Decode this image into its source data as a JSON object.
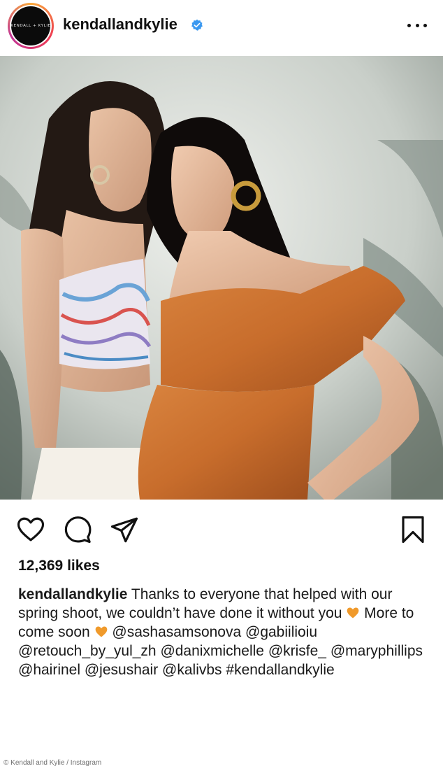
{
  "header": {
    "avatar_logo_text": "KENDALL + KYLIE",
    "username": "kendallandkylie",
    "verified_icon": "verified-badge-icon",
    "more_icon": "more-options-icon"
  },
  "post": {
    "image_description_icon": "photo-content",
    "actions": {
      "like_icon": "heart-icon",
      "comment_icon": "comment-icon",
      "share_icon": "send-icon",
      "save_icon": "bookmark-icon"
    },
    "likes": "12,369 likes",
    "caption": {
      "username": "kendallandkylie",
      "text_1": "Thanks to everyone that helped with our spring shoot, we couldn’t have done it without you",
      "text_2": "More to come soon",
      "mentions_1": "@sashasamsonova @gabiilioiu @retouch_by_yul_zh @danixmichelle @krisfe_ @maryphillips @hairinel @jesushair @kalivbs #kendallandkylie",
      "emoji_icon": "orange-heart-icon"
    }
  },
  "credit": "© Kendall and Kylie / Instagram",
  "colors": {
    "accent_verified": "#3897f0",
    "orange_heart": "#f09a2b"
  }
}
